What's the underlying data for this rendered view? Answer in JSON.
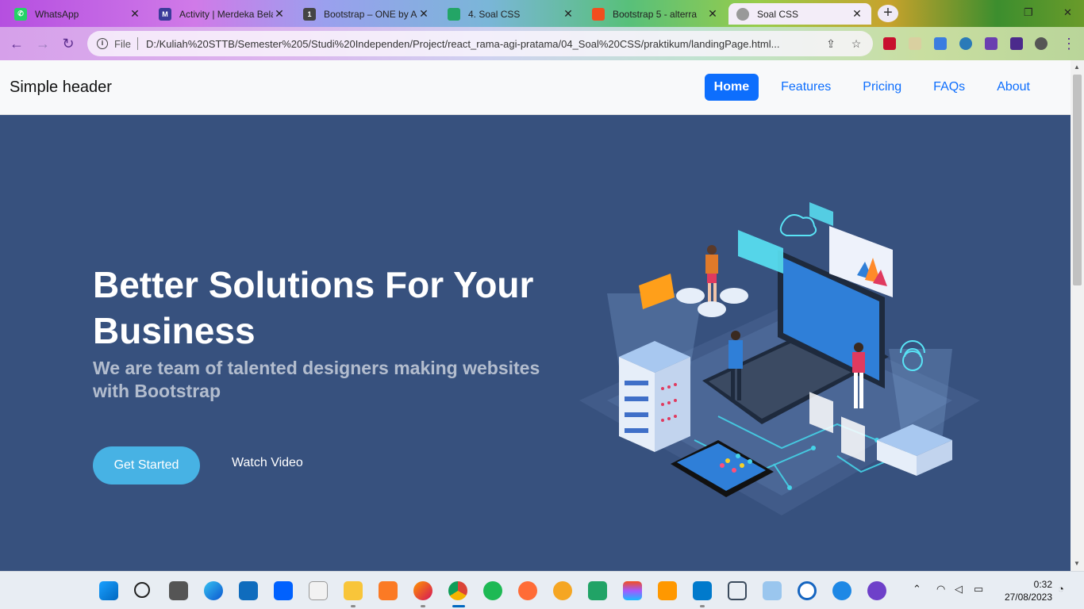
{
  "browser": {
    "tabs": [
      {
        "title": "WhatsApp",
        "icon": "whatsapp-icon",
        "color": "#25d366"
      },
      {
        "title": "Activity | Merdeka Bela",
        "icon": "merdeka-icon",
        "color": "#3b3b9a"
      },
      {
        "title": "Bootstrap – ONE by A",
        "icon": "one-icon",
        "color": "#444444"
      },
      {
        "title": "4. Soal CSS",
        "icon": "docs-icon",
        "color": "#23a566"
      },
      {
        "title": "Bootstrap 5 - alterra",
        "icon": "figma-icon",
        "color": "#f24e1e"
      },
      {
        "title": "Soal CSS",
        "icon": "globe-icon",
        "color": "#777777"
      }
    ],
    "active_tab": 5,
    "new_tab_label": "+",
    "address": {
      "scheme_label": "File",
      "url": "D:/Kuliah%20STTB/Semester%205/Studi%20Independen/Project/react_rama-agi-pratama/04_Soal%20CSS/praktikum/landingPage.html..."
    }
  },
  "site": {
    "brand": "Simple header",
    "nav": [
      "Home",
      "Features",
      "Pricing",
      "FAQs",
      "About"
    ],
    "hero": {
      "title": "Better Solutions For Your Business",
      "subtitle": "We are team of talented designers making websites with Bootstrap",
      "primary_button": "Get Started",
      "secondary_button": "Watch Video"
    },
    "colors": {
      "hero_bg": "#37517e",
      "accent": "#47b2e4",
      "nav_active": "#0d6efd"
    }
  },
  "taskbar": {
    "apps": [
      "start-icon",
      "search-icon",
      "task-view-icon",
      "edge-icon",
      "mail-icon",
      "dropbox-icon",
      "amazon-icon",
      "file-explorer-icon",
      "xampp-icon",
      "firefox-icon",
      "chrome-icon",
      "spotify-icon",
      "postman-icon",
      "pcloud-icon",
      "notion-like-icon",
      "figma-icon",
      "sublime-icon",
      "vscode-icon",
      "virtualbox-icon",
      "3d-icon",
      "browser-icon",
      "mysql-icon",
      "github-icon"
    ],
    "time": "0:32",
    "date": "27/08/2023"
  }
}
